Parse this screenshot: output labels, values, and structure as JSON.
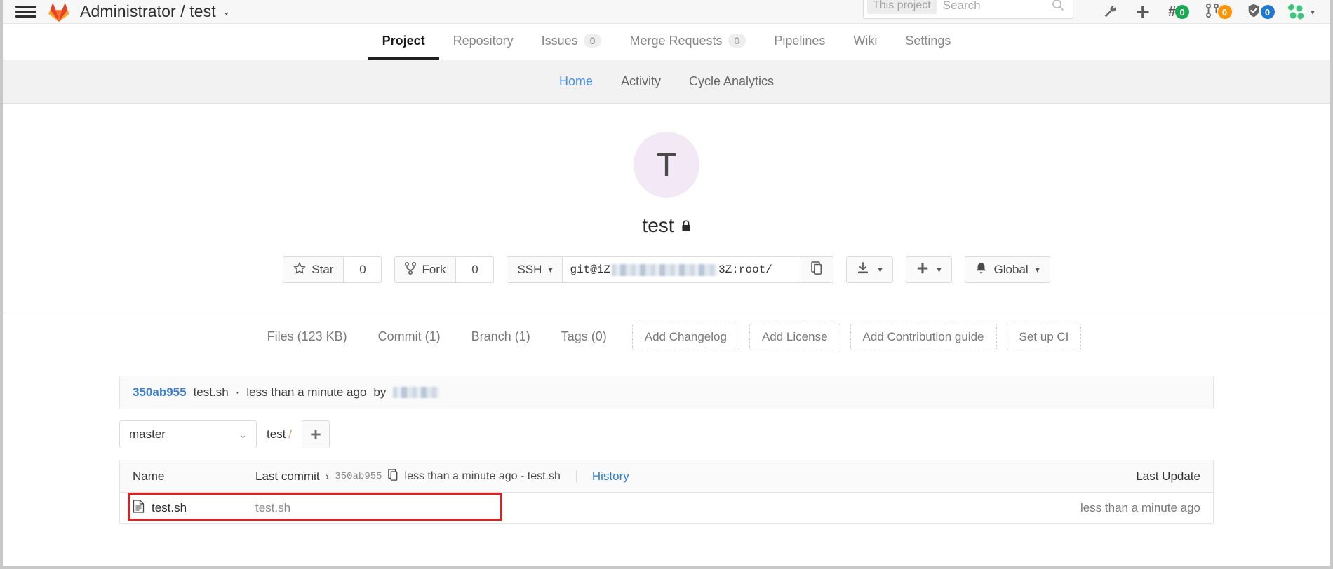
{
  "topbar": {
    "menu_icon": "hamburger-icon",
    "logo_icon": "gitlab-tanuki-logo",
    "project_breadcrumb": "Administrator / test",
    "breadcrumb_caret": "⌄",
    "search": {
      "scope": "This project",
      "placeholder": "Search",
      "value": ""
    },
    "icons": [
      {
        "name": "admin-wrench-icon",
        "glyph": "wrench"
      },
      {
        "name": "new-item-plus-icon",
        "glyph": "plus"
      },
      {
        "name": "issues-icon",
        "glyph": "#",
        "count": "0",
        "color": "#1aaa55"
      },
      {
        "name": "merge-requests-icon",
        "glyph": "mr",
        "count": "0",
        "color": "#fc9403"
      },
      {
        "name": "todos-icon",
        "glyph": "check",
        "count": "0",
        "color": "#1f78d1"
      }
    ],
    "user_caret": "▾"
  },
  "nav": {
    "tabs": [
      {
        "label": "Project",
        "count": null,
        "active": true
      },
      {
        "label": "Repository",
        "count": null,
        "active": false
      },
      {
        "label": "Issues",
        "count": "0",
        "active": false
      },
      {
        "label": "Merge Requests",
        "count": "0",
        "active": false
      },
      {
        "label": "Pipelines",
        "count": null,
        "active": false
      },
      {
        "label": "Wiki",
        "count": null,
        "active": false
      },
      {
        "label": "Settings",
        "count": null,
        "active": false
      }
    ]
  },
  "subnav": {
    "items": [
      {
        "label": "Home",
        "active": true
      },
      {
        "label": "Activity",
        "active": false
      },
      {
        "label": "Cycle Analytics",
        "active": false
      }
    ]
  },
  "hero": {
    "avatar_initial": "T",
    "project_name": "test",
    "visibility_icon": "lock-icon"
  },
  "actions": {
    "star_label": "Star",
    "star_count": "0",
    "star_icon": "star-icon",
    "fork_label": "Fork",
    "fork_count": "0",
    "fork_icon": "fork-icon",
    "clone_protocol": "SSH",
    "clone_url_prefix": "git@iZ",
    "clone_url_suffix": "3Z:root/",
    "copy_icon": "copy-clipboard-icon",
    "download_icon": "download-icon",
    "plus_icon": "plus-icon",
    "notification_icon": "bell-icon",
    "notification_label": "Global",
    "caret": "▾"
  },
  "stats": {
    "items": [
      {
        "label": "Files (123 KB)"
      },
      {
        "label": "Commit (1)"
      },
      {
        "label": "Branch (1)"
      },
      {
        "label": "Tags (0)"
      }
    ],
    "dashed_buttons": [
      {
        "label": "Add Changelog"
      },
      {
        "label": "Add License"
      },
      {
        "label": "Add Contribution guide"
      },
      {
        "label": "Set up CI"
      }
    ]
  },
  "commit_banner": {
    "sha": "350ab955",
    "message": "test.sh",
    "separator": "·",
    "time": "less than a minute ago",
    "by_label": "by",
    "author_redacted": true
  },
  "repo_controls": {
    "branch": "master",
    "branch_caret": "⌄",
    "breadcrumb_root": "test",
    "breadcrumb_slash": "/",
    "add_button_icon": "plus-icon"
  },
  "file_table": {
    "headers": {
      "name": "Name",
      "last_commit_label": "Last commit",
      "last_commit_chevron": "›",
      "last_commit_sha": "350ab955",
      "last_commit_copy_icon": "copy-icon",
      "last_commit_text": "less than a minute ago - test.sh",
      "history": "History",
      "last_update": "Last Update"
    },
    "rows": [
      {
        "icon": "file-icon",
        "name": "test.sh",
        "commit_message": "test.sh",
        "last_update": "less than a minute ago",
        "highlighted": true
      }
    ]
  },
  "annotation": {
    "highlight_color": "#e02020"
  }
}
